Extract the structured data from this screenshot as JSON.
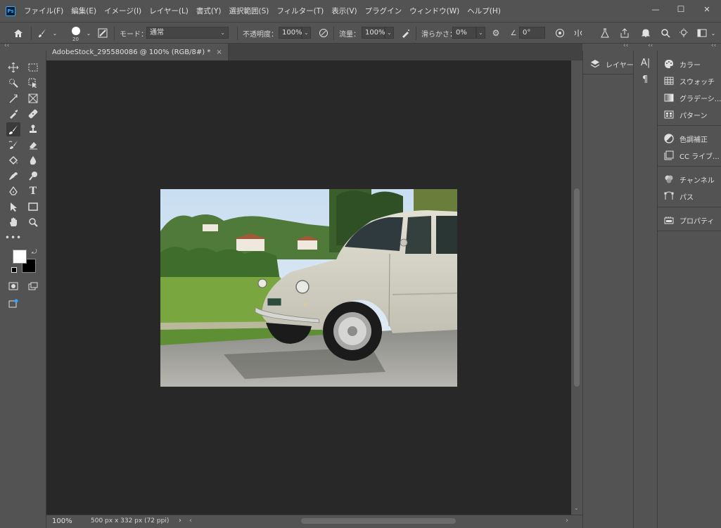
{
  "menu": {
    "logo": "Ps",
    "items": [
      "ファイル(F)",
      "編集(E)",
      "イメージ(I)",
      "レイヤー(L)",
      "書式(Y)",
      "選択範囲(S)",
      "フィルター(T)",
      "表示(V)",
      "プラグイン",
      "ウィンドウ(W)",
      "ヘルプ(H)"
    ]
  },
  "window_controls": {
    "minimize": "—",
    "maximize": "☐",
    "close": "✕"
  },
  "options": {
    "brush_size": "20",
    "mode_label": "モード：",
    "mode_value": "通常",
    "opacity_label": "不透明度：",
    "opacity_value": "100%",
    "flow_label": "流量：",
    "flow_value": "100%",
    "smoothing_label": "滑らかさ：",
    "smoothing_value": "0%",
    "angle_value": "0°"
  },
  "collapse": {
    "arrows": "‹‹"
  },
  "document": {
    "tab_title": "AdobeStock_295580086 @ 100% (RGB/8#) *",
    "tab_close": "×"
  },
  "status": {
    "zoom": "100%",
    "info": "500 px x 332 px (72 ppi)",
    "more": "›",
    "scroll_left": "‹",
    "scroll_right": "›"
  },
  "panels": {
    "layers": "レイヤー",
    "color": "カラー",
    "swatches": "スウォッチ",
    "gradients": "グラデーシ...",
    "patterns": "パターン",
    "adjustments": "色調補正",
    "cc_libraries": "CC ライブ...",
    "channels": "チャンネル",
    "paths": "パス",
    "properties": "プロパティ"
  },
  "colors": {
    "ui_bg": "#535353",
    "canvas_bg": "#282828",
    "foreground": "#ffffff",
    "background": "#000000",
    "accent": "#31a8ff"
  }
}
